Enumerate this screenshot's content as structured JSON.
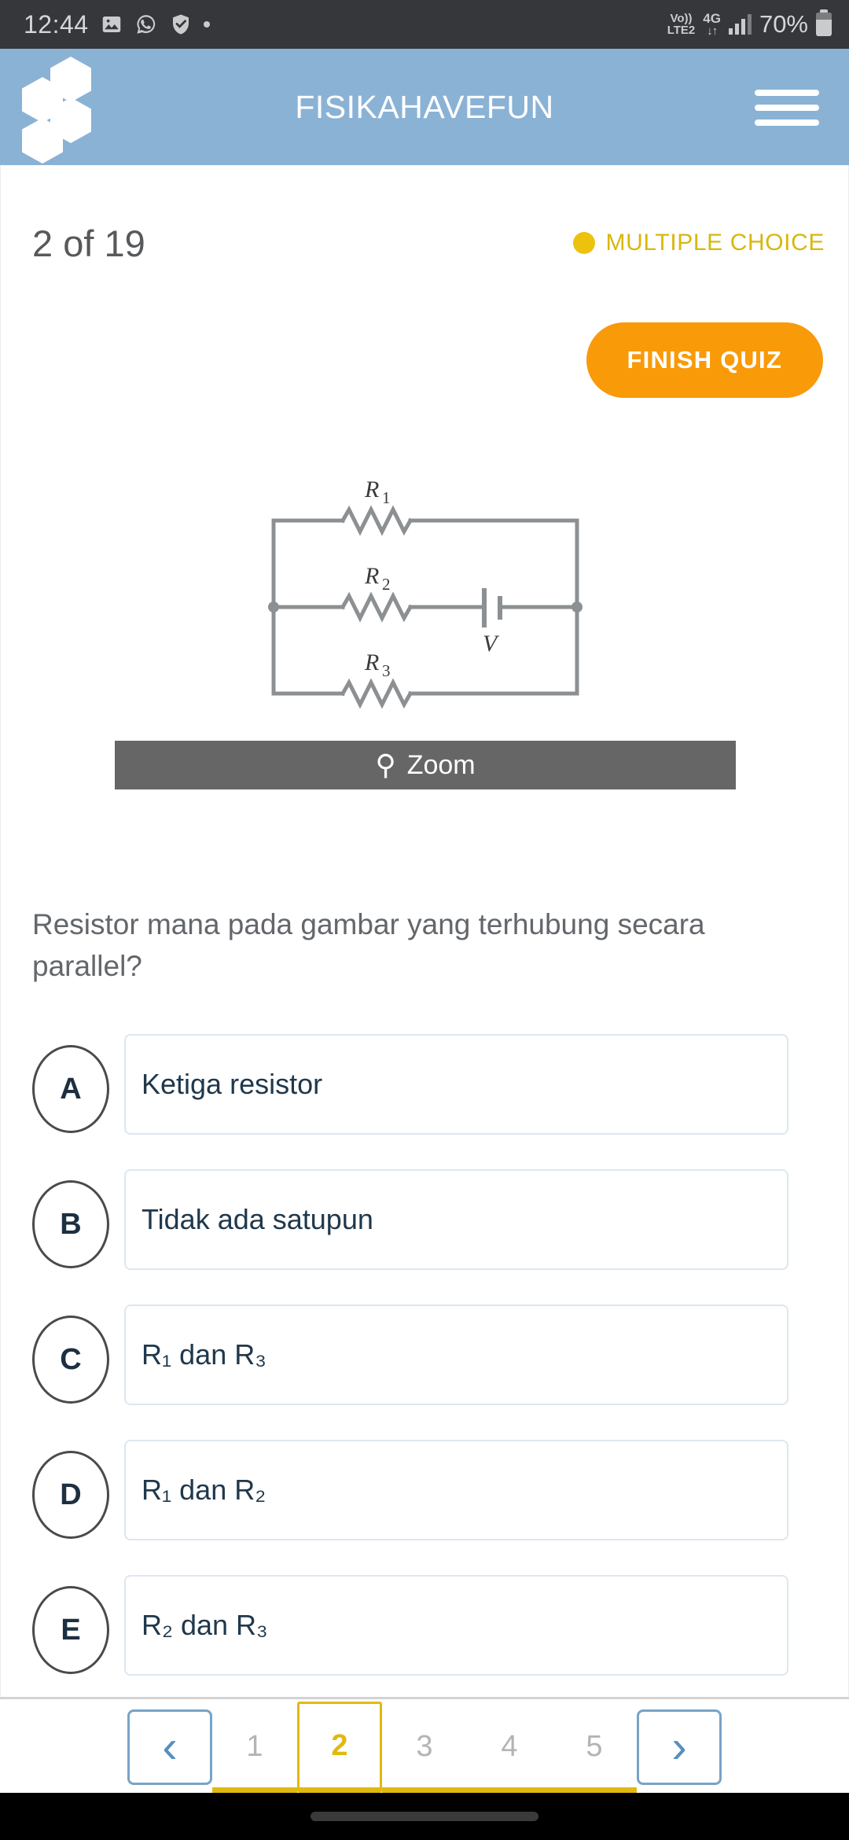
{
  "status_bar": {
    "time": "12:44",
    "icons": [
      "photo-icon",
      "whatsapp-icon",
      "shield-check-icon",
      "dot-icon"
    ],
    "volte_top": "Vo))",
    "volte_bottom": "LTE2",
    "network": "4G",
    "network_arrows": "↓↑",
    "battery_percent": "70%"
  },
  "app_bar": {
    "title": "FISIKAHAVEFUN"
  },
  "quiz": {
    "progress_label": "2 of 19",
    "question_type": "MULTIPLE CHOICE",
    "finish_label": "FINISH QUIZ",
    "zoom_label": "Zoom",
    "question_text": "Resistor mana pada gambar yang terhubung secara parallel?",
    "figure": {
      "labels": [
        "R",
        "1",
        "R",
        "2",
        "R",
        "3",
        "V"
      ],
      "r1": "R",
      "r1sub": "1",
      "r2": "R",
      "r2sub": "2",
      "r3": "R",
      "r3sub": "3",
      "source": "V"
    },
    "options": [
      {
        "letter": "A",
        "text": "Ketiga resistor",
        "sub_parts": null
      },
      {
        "letter": "B",
        "text": "Tidak ada satupun",
        "sub_parts": null
      },
      {
        "letter": "C",
        "text": "R₁ dan R₃",
        "sub_parts": [
          "R",
          "1",
          " dan R",
          "3"
        ]
      },
      {
        "letter": "D",
        "text": "R₁ dan R₂",
        "sub_parts": [
          "R",
          "1",
          " dan R",
          "2"
        ]
      },
      {
        "letter": "E",
        "text": "R₂ dan R₃",
        "sub_parts": [
          "R",
          "2",
          " dan R",
          "3"
        ]
      }
    ]
  },
  "pagination": {
    "prev": "‹",
    "next": "›",
    "pages": [
      "1",
      "2",
      "3",
      "4",
      "5"
    ],
    "current": "2"
  },
  "colors": {
    "header_blue": "#8ab2d5",
    "accent_orange": "#f99a09",
    "accent_yellow": "#e0b910",
    "type_yellow": "#d9b70c",
    "option_border": "#dde7f0",
    "option_text": "#20384c",
    "zoom_bar": "#666666",
    "status_bg": "#35373b",
    "nav_bg": "#000000"
  }
}
